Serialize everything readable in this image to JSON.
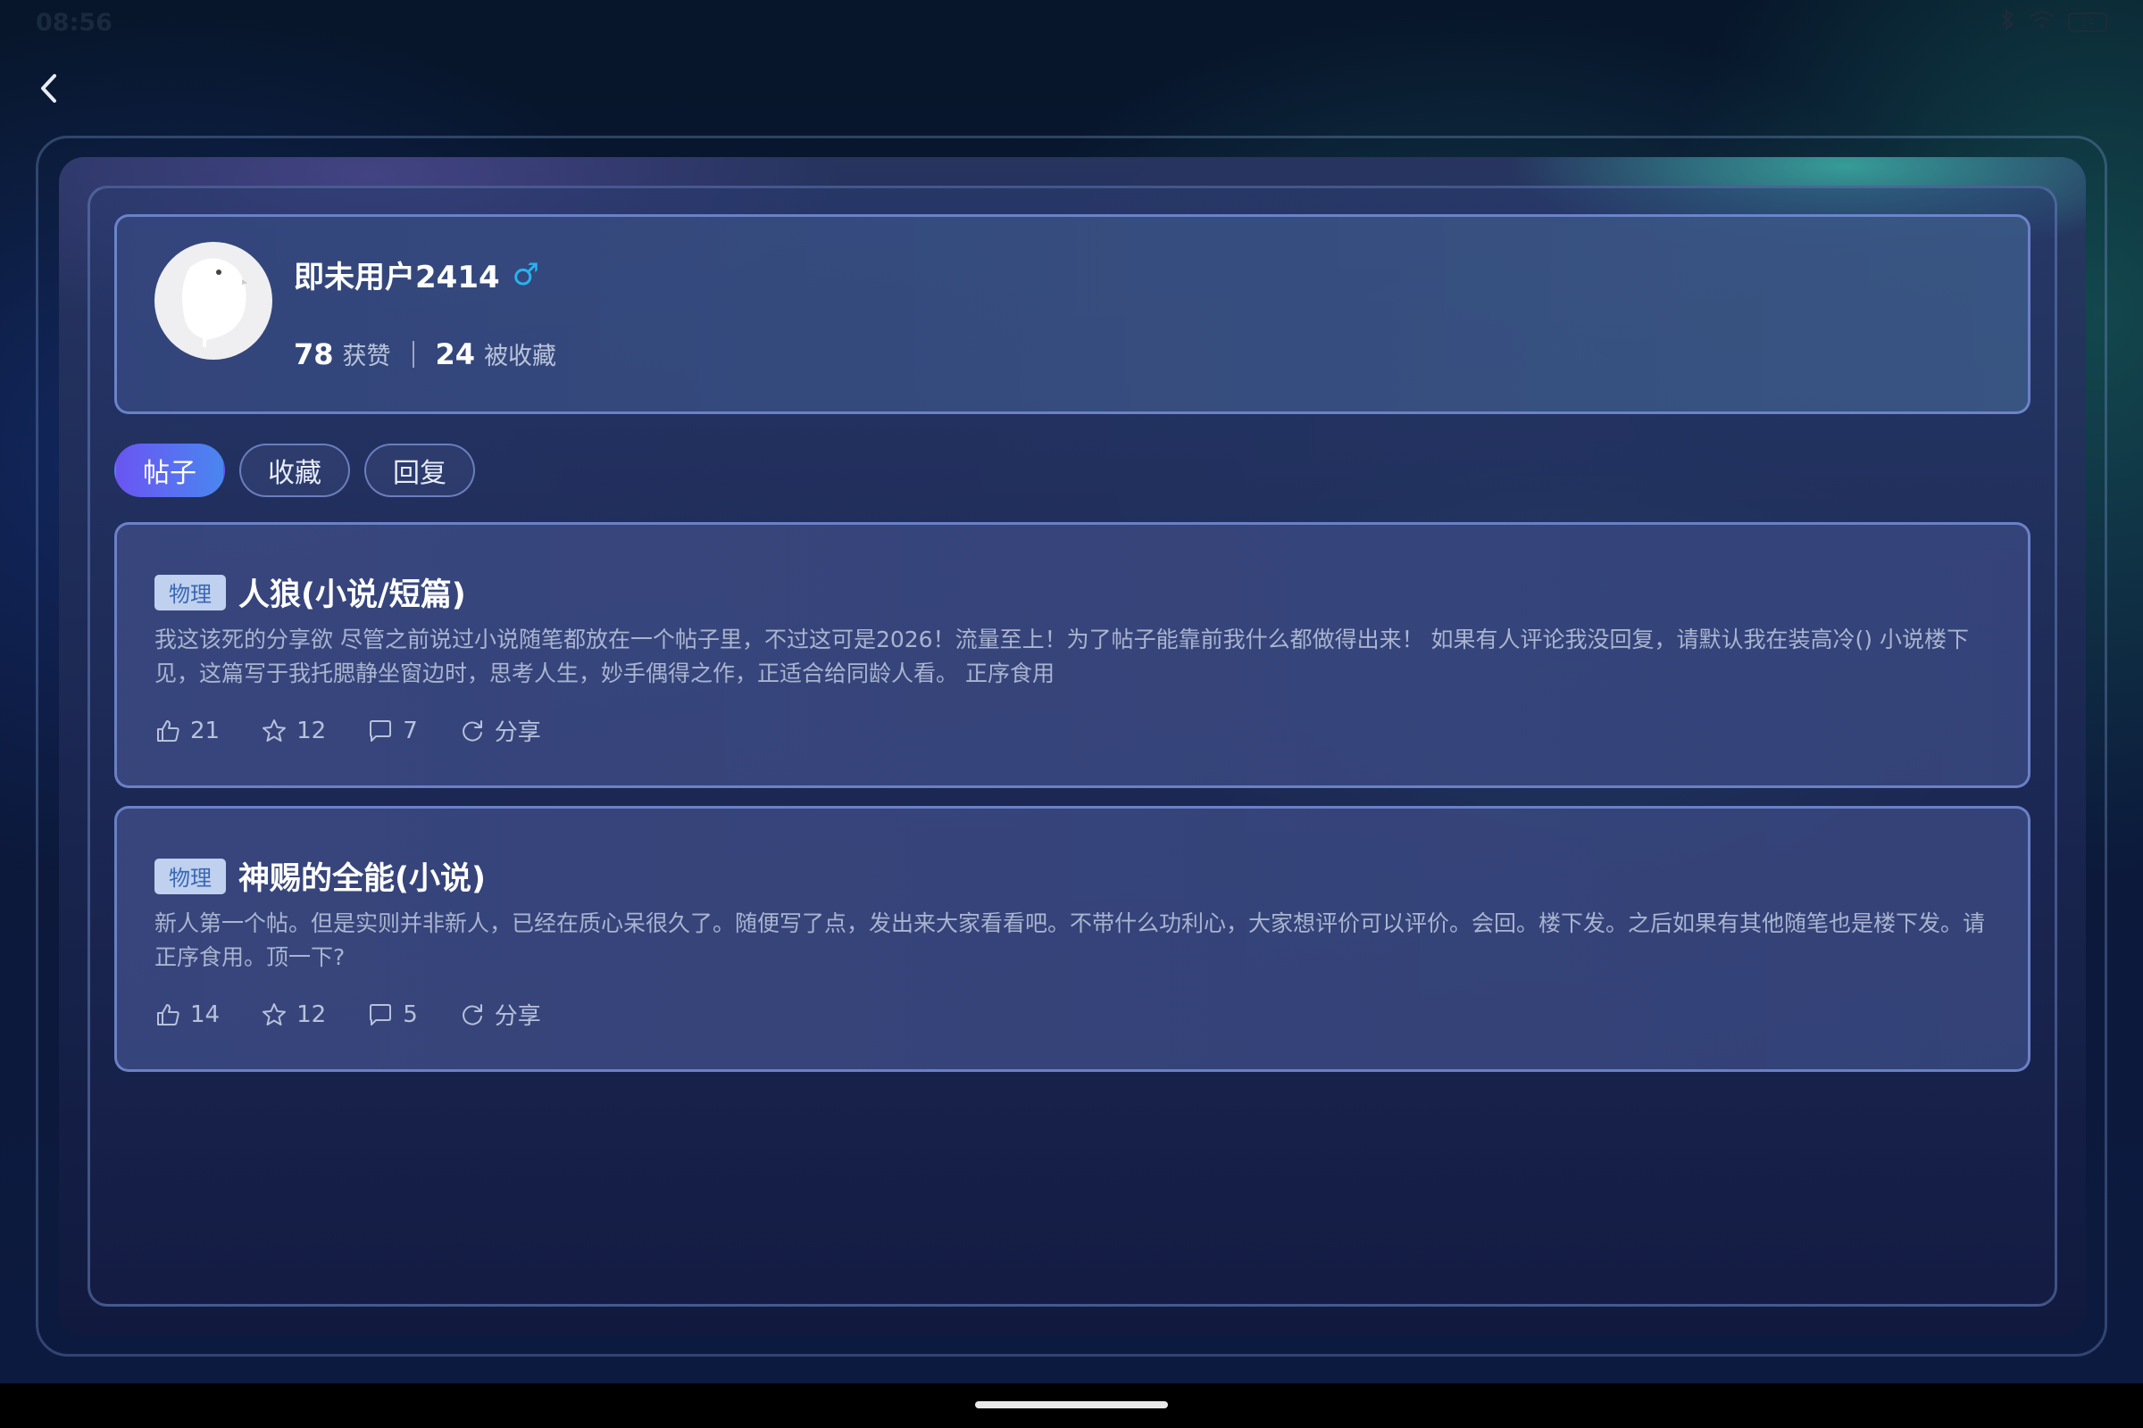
{
  "status_bar": {
    "time": "08:56",
    "battery": "24"
  },
  "profile": {
    "username": "即未用户2414",
    "gender_symbol": "♂",
    "stats": [
      {
        "value": "78",
        "label": "获赞"
      },
      {
        "value": "24",
        "label": "被收藏"
      }
    ]
  },
  "tabs": [
    {
      "label": "帖子",
      "active": true
    },
    {
      "label": "收藏",
      "active": false
    },
    {
      "label": "回复",
      "active": false
    }
  ],
  "posts": [
    {
      "tag": "物理",
      "title": "人狼(小说/短篇)",
      "body": "我这该死的分享欲 尽管之前说过小说随笔都放在一个帖子里，不过这可是2026！流量至上！为了帖子能靠前我什么都做得出来！ 如果有人评论我没回复，请默认我在装高冷() 小说楼下见，这篇写于我托腮静坐窗边时，思考人生，妙手偶得之作，正适合给同龄人看。 正序食用",
      "likes": "21",
      "favorites": "12",
      "comments": "7",
      "share_label": "分享"
    },
    {
      "tag": "物理",
      "title": "神赐的全能(小说)",
      "body": "新人第一个帖。但是实则并非新人，已经在质心呆很久了。随便写了点，发出来大家看看吧。不带什么功利心，大家想评价可以评价。会回。楼下发。之后如果有其他随笔也是楼下发。请正序食用。顶一下?",
      "likes": "14",
      "favorites": "12",
      "comments": "5",
      "share_label": "分享"
    }
  ],
  "colors": {
    "accent_start": "#6a55f2",
    "accent_end": "#4a86f0",
    "gender": "#2ab2ef",
    "tag_bg": "#bfd1ee",
    "tag_text": "#3b67b5"
  }
}
